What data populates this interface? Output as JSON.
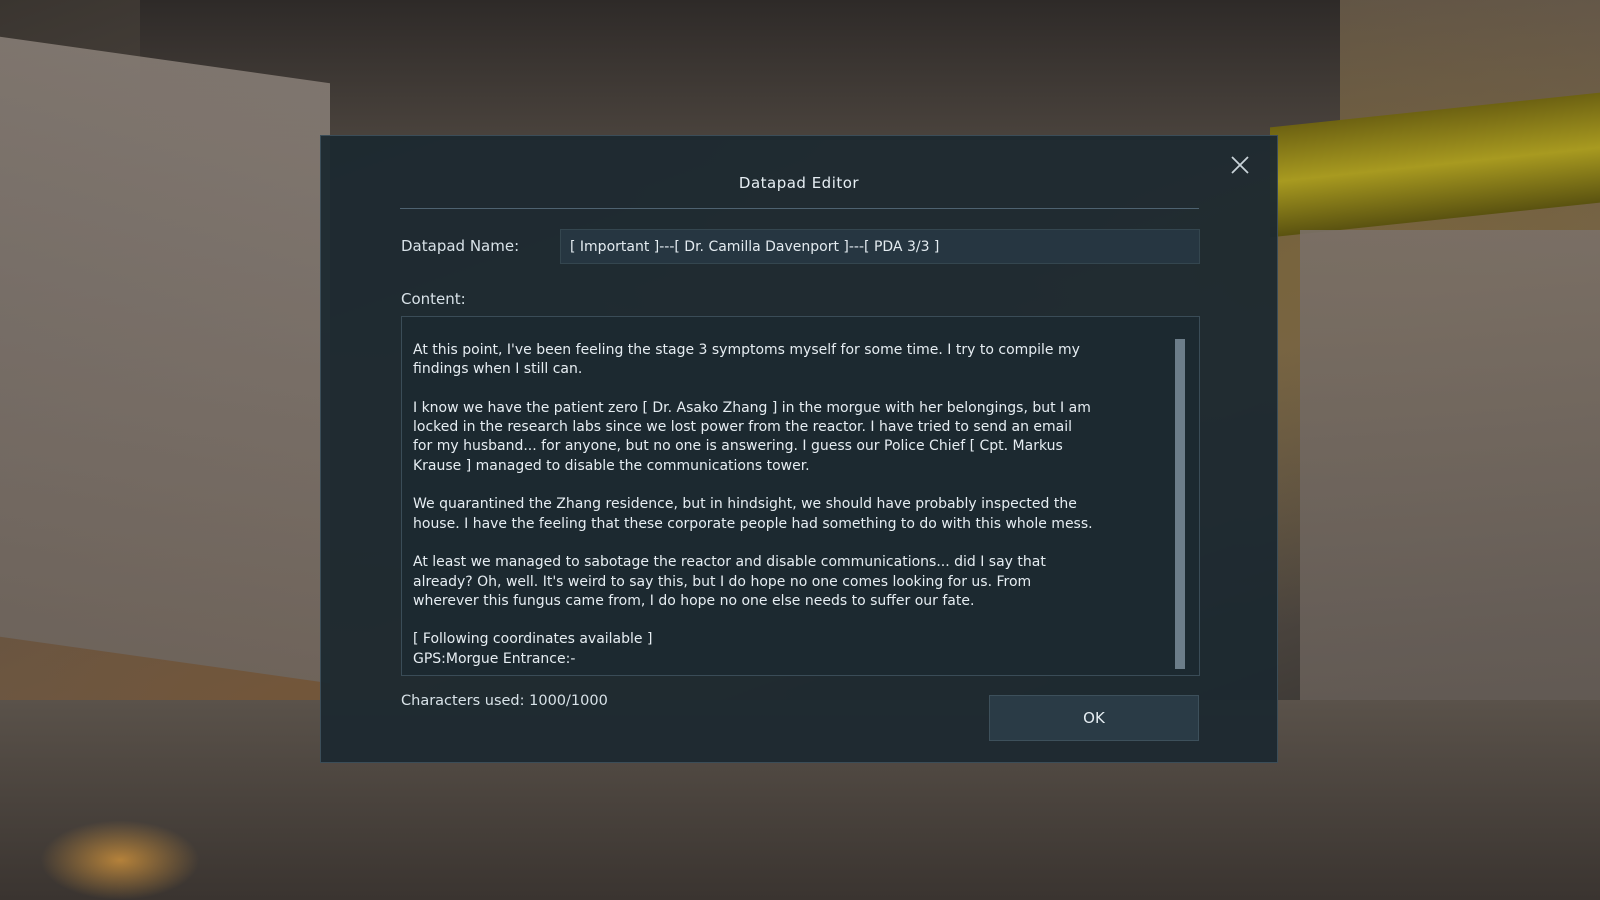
{
  "dialog": {
    "title": "Datapad Editor",
    "close_icon": "close-icon",
    "name_label": "Datapad Name:",
    "name_value": "[ Important ]---[ Dr. Camilla Davenport ]---[ PDA 3/3 ]",
    "content_label": "Content:",
    "content_text": "At this point, I've been feeling the stage 3 symptoms myself for some time. I try to compile my\nfindings when I still can.\n\nI know we have the patient zero [ Dr. Asako Zhang ] in the morgue with her belongings, but I am\nlocked in the research labs since we lost power from the reactor. I have tried to send an email\nfor my husband... for anyone, but no one is answering. I guess our Police Chief [ Cpt. Markus\nKrause ] managed to disable the communications tower.\n\nWe quarantined the Zhang residence, but in hindsight, we should have probably inspected the\nhouse. I have the feeling that these corporate people had something to do with this whole mess.\n\nAt least we managed to sabotage the reactor and disable communications... did I say that\nalready? Oh, well. It's weird to say this, but I do hope no one comes looking for us. From\nwherever this fungus came from, I do hope no one else needs to suffer our fate.\n\n[ Following coordinates available ]\nGPS:Morgue Entrance:-",
    "char_count": "Characters used: 1000/1000",
    "ok_label": "OK"
  },
  "colors": {
    "dialog_bg": "#1c2830",
    "input_bg": "#263641",
    "text": "#e6eef3"
  }
}
